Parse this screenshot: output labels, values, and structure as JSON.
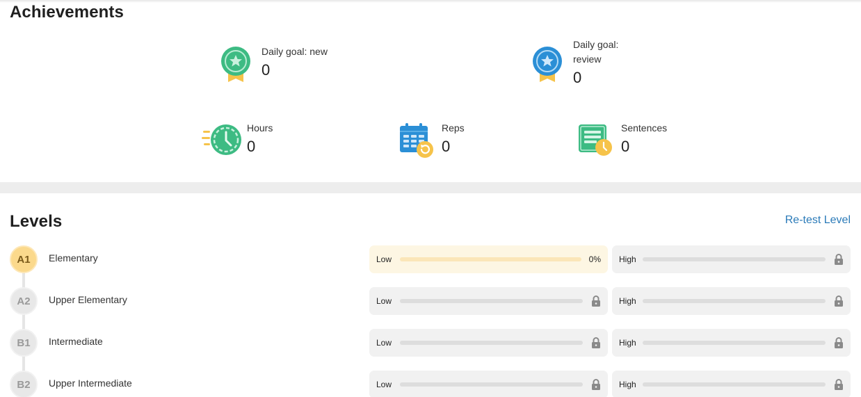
{
  "achievements": {
    "title": "Achievements",
    "goals": [
      {
        "label": "Daily goal: new",
        "value": "0",
        "icon": "green-medal-icon"
      },
      {
        "label": "Daily goal: review",
        "value": "0",
        "icon": "blue-medal-icon"
      }
    ],
    "stats": [
      {
        "label": "Hours",
        "value": "0",
        "icon": "clock-icon"
      },
      {
        "label": "Reps",
        "value": "0",
        "icon": "calendar-repeat-icon"
      },
      {
        "label": "Sentences",
        "value": "0",
        "icon": "document-clock-icon"
      }
    ]
  },
  "levels": {
    "title": "Levels",
    "retest_label": "Re-test Level",
    "items": [
      {
        "code": "A1",
        "name": "Elementary",
        "status": "active",
        "low": {
          "label": "Low",
          "progress": 0,
          "progress_text": "0%",
          "locked": false
        },
        "high": {
          "label": "High",
          "progress": 0,
          "locked": true
        }
      },
      {
        "code": "A2",
        "name": "Upper Elementary",
        "status": "locked",
        "low": {
          "label": "Low",
          "progress": 0,
          "locked": true
        },
        "high": {
          "label": "High",
          "progress": 0,
          "locked": true
        }
      },
      {
        "code": "B1",
        "name": "Intermediate",
        "status": "locked",
        "low": {
          "label": "Low",
          "progress": 0,
          "locked": true
        },
        "high": {
          "label": "High",
          "progress": 0,
          "locked": true
        }
      },
      {
        "code": "B2",
        "name": "Upper Intermediate",
        "status": "locked",
        "low": {
          "label": "Low",
          "progress": 0,
          "locked": true
        },
        "high": {
          "label": "High",
          "progress": 0,
          "locked": true
        }
      }
    ]
  },
  "colors": {
    "link": "#2a7ab8",
    "active_level": "#fbd98c",
    "progress_fill": "#f5b82e",
    "medal_green": "#3dbb83",
    "medal_blue": "#2b8fd6"
  }
}
